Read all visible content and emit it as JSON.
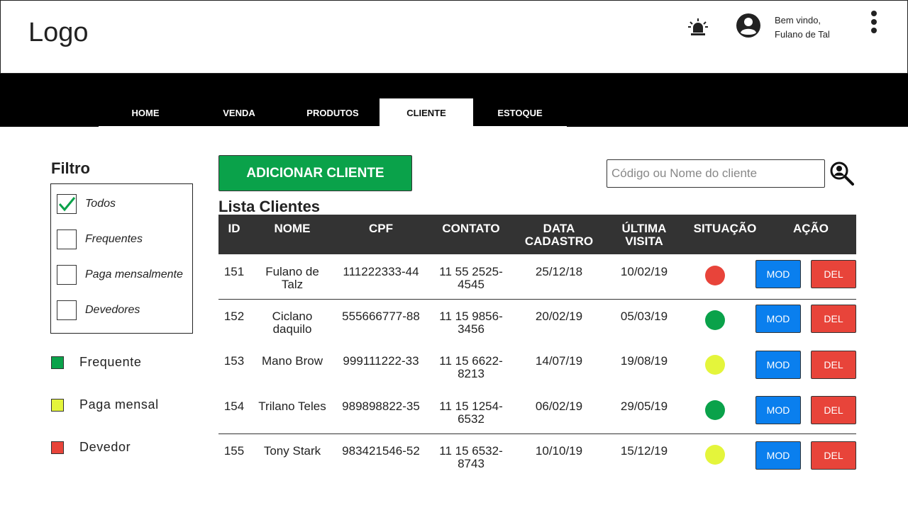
{
  "header": {
    "logo": "Logo",
    "welcome_line1": "Bem vindo,",
    "welcome_line2": "Fulano de Tal",
    "icons": [
      "alarm-icon",
      "user-avatar-icon",
      "more-vertical-icon"
    ]
  },
  "nav": {
    "tabs": [
      {
        "label": "HOME",
        "active": false
      },
      {
        "label": "VENDA",
        "active": false
      },
      {
        "label": "PRODUTOS",
        "active": false
      },
      {
        "label": "CLIENTE",
        "active": true
      },
      {
        "label": "ESTOQUE",
        "active": false
      }
    ]
  },
  "filter": {
    "title": "Filtro",
    "options": [
      {
        "label": "Todos",
        "checked": true
      },
      {
        "label": "Frequentes",
        "checked": false
      },
      {
        "label": "Paga mensalmente",
        "checked": false
      },
      {
        "label": "Devedores",
        "checked": false
      }
    ]
  },
  "legend": [
    {
      "label": "Frequente",
      "color": "#0aa24a"
    },
    {
      "label": "Paga mensal",
      "color": "#e4f53b"
    },
    {
      "label": "Devedor",
      "color": "#e8443a"
    }
  ],
  "main": {
    "add_button": "ADICIONAR CLIENTE",
    "search_placeholder": "Código ou Nome do cliente",
    "list_title": "Lista Clientes"
  },
  "table": {
    "headers": {
      "id": "ID",
      "nome": "NOME",
      "cpf": "CPF",
      "contato": "CONTATO",
      "data_cadastro_1": "DATA",
      "data_cadastro_2": "CADASTRO",
      "ultima_visita_1": "ÚLTIMA",
      "ultima_visita_2": "VISITA",
      "situacao": "SITUAÇÃO",
      "acao": "AÇÃO"
    },
    "rows": [
      {
        "id": "151",
        "nome_1": "Fulano de",
        "nome_2": "Talz",
        "cpf": "111222333-44",
        "contato_1": "11 55 2525-",
        "contato_2": "4545",
        "data_cadastro": "25/12/18",
        "ultima_visita": "10/02/19",
        "situacao": "Devedor",
        "status_color": "#e8443a",
        "mod": "MOD",
        "del": "DEL"
      },
      {
        "id": "152",
        "nome_1": "Ciclano",
        "nome_2": "daquilo",
        "cpf": "555666777-88",
        "contato_1": "11 15 9856-",
        "contato_2": "3456",
        "data_cadastro": "20/02/19",
        "ultima_visita": "05/03/19",
        "situacao": "Frequente",
        "status_color": "#0aa24a",
        "mod": "MOD",
        "del": "DEL"
      },
      {
        "id": "153",
        "nome_1": "Mano Brow",
        "nome_2": "",
        "cpf": "999111222-33",
        "contato_1": "11 15 6622-",
        "contato_2": "8213",
        "data_cadastro": "14/07/19",
        "ultima_visita": "19/08/19",
        "situacao": "Paga mensal",
        "status_color": "#e4f53b",
        "mod": "MOD",
        "del": "DEL"
      },
      {
        "id": "154",
        "nome_1": "Trilano Teles",
        "nome_2": "",
        "cpf": "989898822-35",
        "contato_1": "11 15 1254-",
        "contato_2": "6532",
        "data_cadastro": "06/02/19",
        "ultima_visita": "29/05/19",
        "situacao": "Frequente",
        "status_color": "#0aa24a",
        "mod": "MOD",
        "del": "DEL"
      },
      {
        "id": "155",
        "nome_1": "Tony Stark",
        "nome_2": "",
        "cpf": "983421546-52",
        "contato_1": "11 15 6532-",
        "contato_2": "8743",
        "data_cadastro": "10/10/19",
        "ultima_visita": "15/12/19",
        "situacao": "Paga mensal",
        "status_color": "#e4f53b",
        "mod": "MOD",
        "del": "DEL"
      }
    ]
  }
}
